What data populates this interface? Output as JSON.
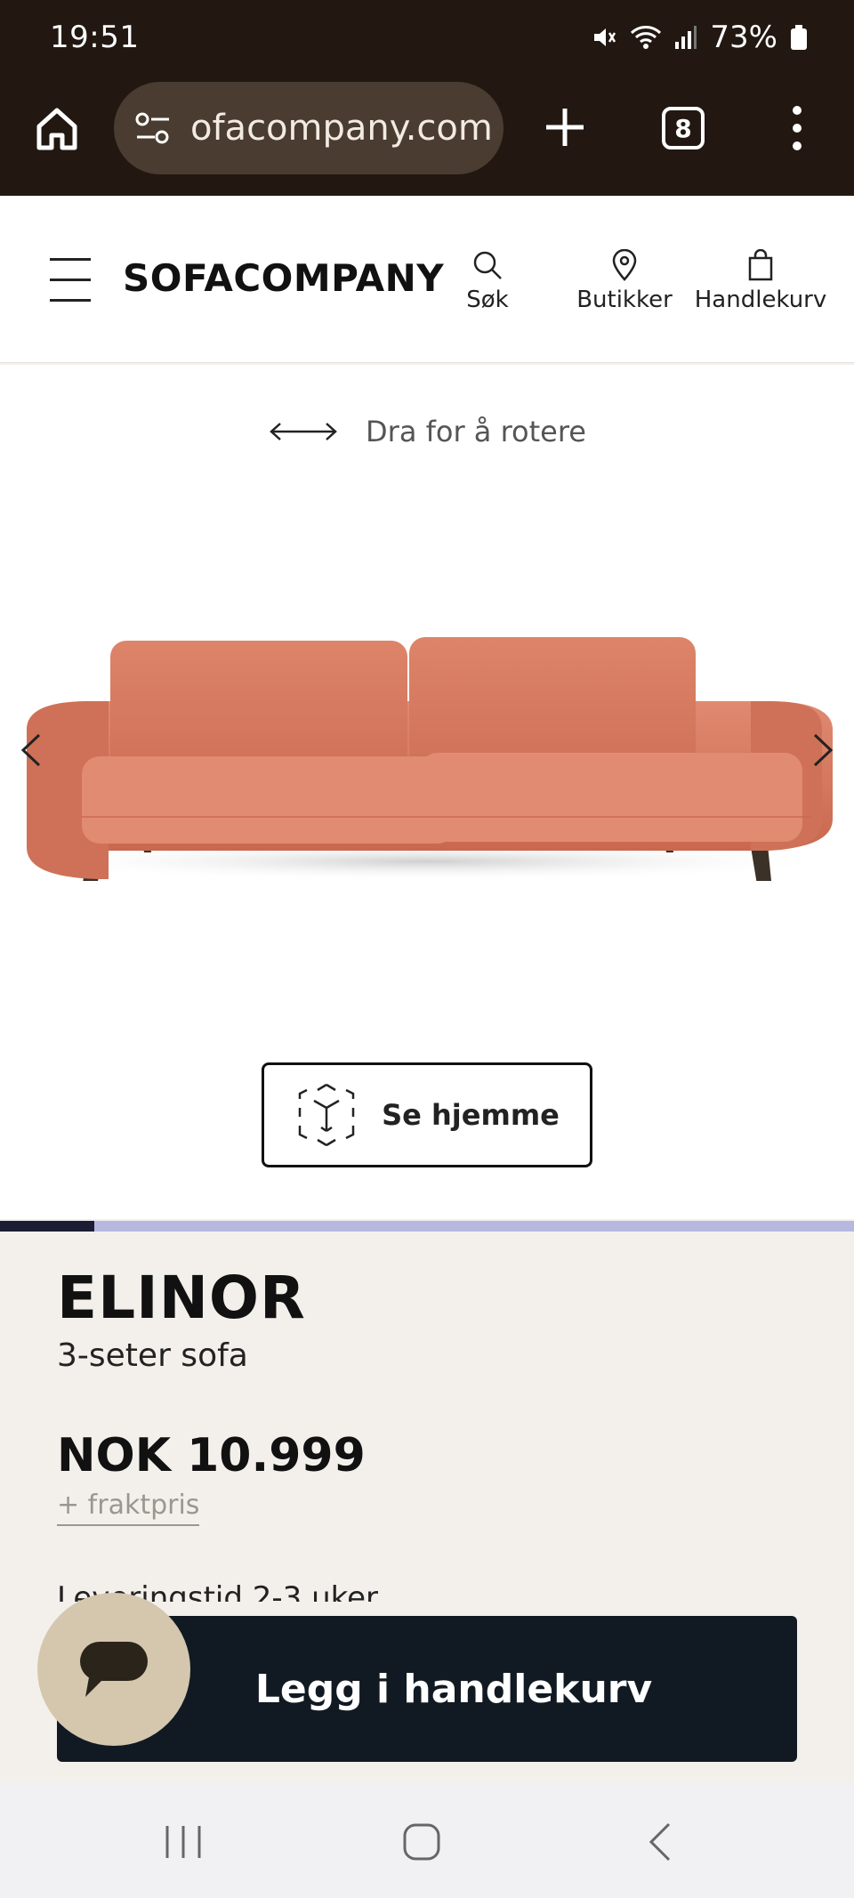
{
  "status_bar": {
    "time": "19:51",
    "battery": "73%",
    "icons": [
      "mute-icon",
      "wifi-icon",
      "signal-icon",
      "battery-icon"
    ]
  },
  "browser": {
    "url": "ofacompany.com",
    "tab_count": "8",
    "icons": [
      "home-icon",
      "site-settings-icon",
      "plus-icon",
      "more-icon"
    ]
  },
  "header": {
    "logo": "SOFACOMPANY",
    "search_label": "Søk",
    "stores_label": "Butikker",
    "cart_label": "Handlekurv"
  },
  "viewer": {
    "rotate_hint": "Dra for å rotere",
    "ar_button": "Se hjemme",
    "image_progress": 0.11,
    "colors": {
      "sofa": "#d97c63",
      "track": "#b6b8df",
      "fill": "#1c1d35"
    }
  },
  "product": {
    "name": "ELINOR",
    "type": "3-seter sofa",
    "price": "NOK 10.999",
    "shipping_link": "+ fraktpris",
    "delivery": "Leveringstid 2-3 uker"
  },
  "cta": {
    "label": "Legg i handlekurv",
    "color": "#111a22"
  },
  "chat": {
    "color": "#d4c7ae",
    "icon": "chat-bubble-icon"
  },
  "nav_bar": {
    "icons": [
      "recents-icon",
      "home-nav-icon",
      "back-icon"
    ]
  }
}
